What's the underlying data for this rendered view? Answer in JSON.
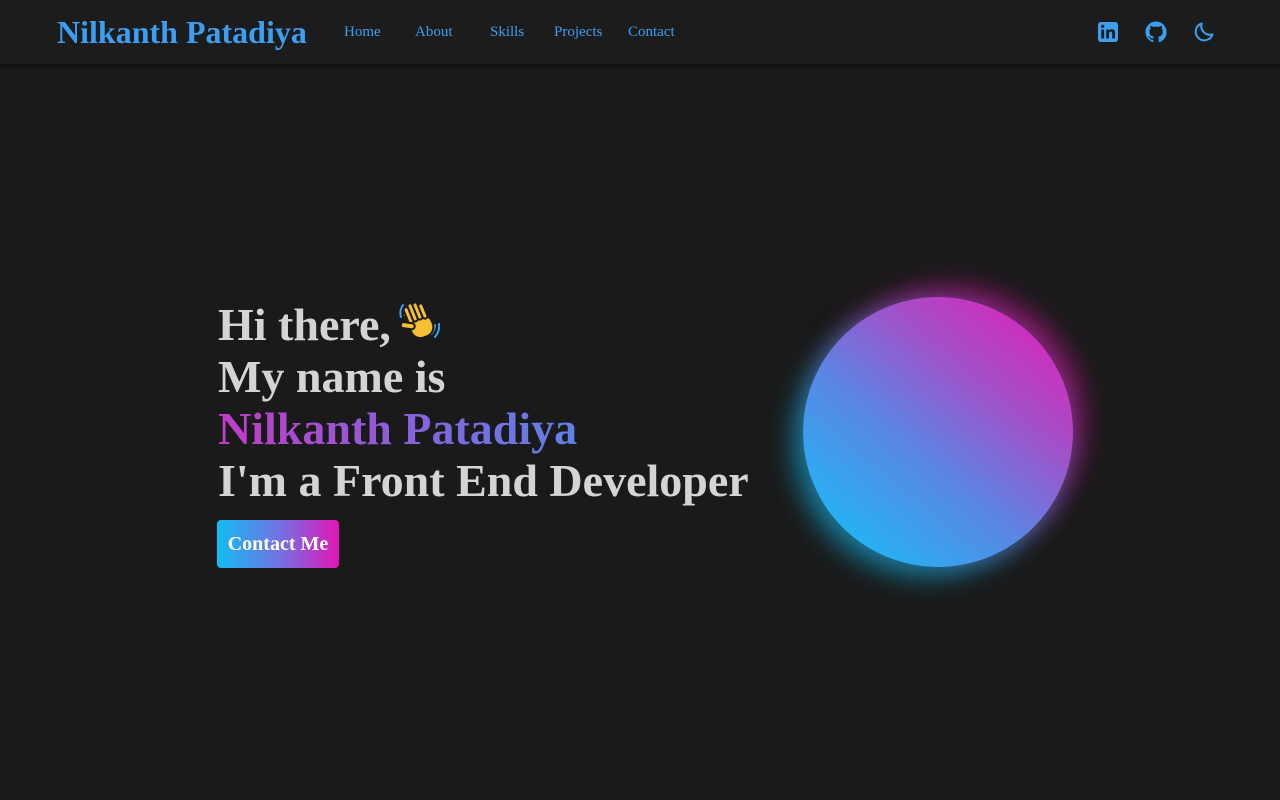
{
  "nav": {
    "brand": "Nilkanth Patadiya",
    "links": [
      "Home",
      "About",
      "Skills",
      "Projects",
      "Contact"
    ],
    "icons": [
      "linkedin-icon",
      "github-icon",
      "moon-icon"
    ],
    "accent_color": "#3c9ef0"
  },
  "hero": {
    "greeting": "Hi there,",
    "greeting_icon": "waving-hand-icon",
    "intro": "My name is",
    "name": "Nilkanth Patadiya",
    "role": "I'm a Front End Developer",
    "cta_label": "Contact Me",
    "gradient_colors": [
      "#12bdf4",
      "#e215b6"
    ]
  },
  "colors": {
    "background": "#1a1a1a",
    "navbar": "#1c1c1c",
    "text": "#d4d4d4"
  }
}
